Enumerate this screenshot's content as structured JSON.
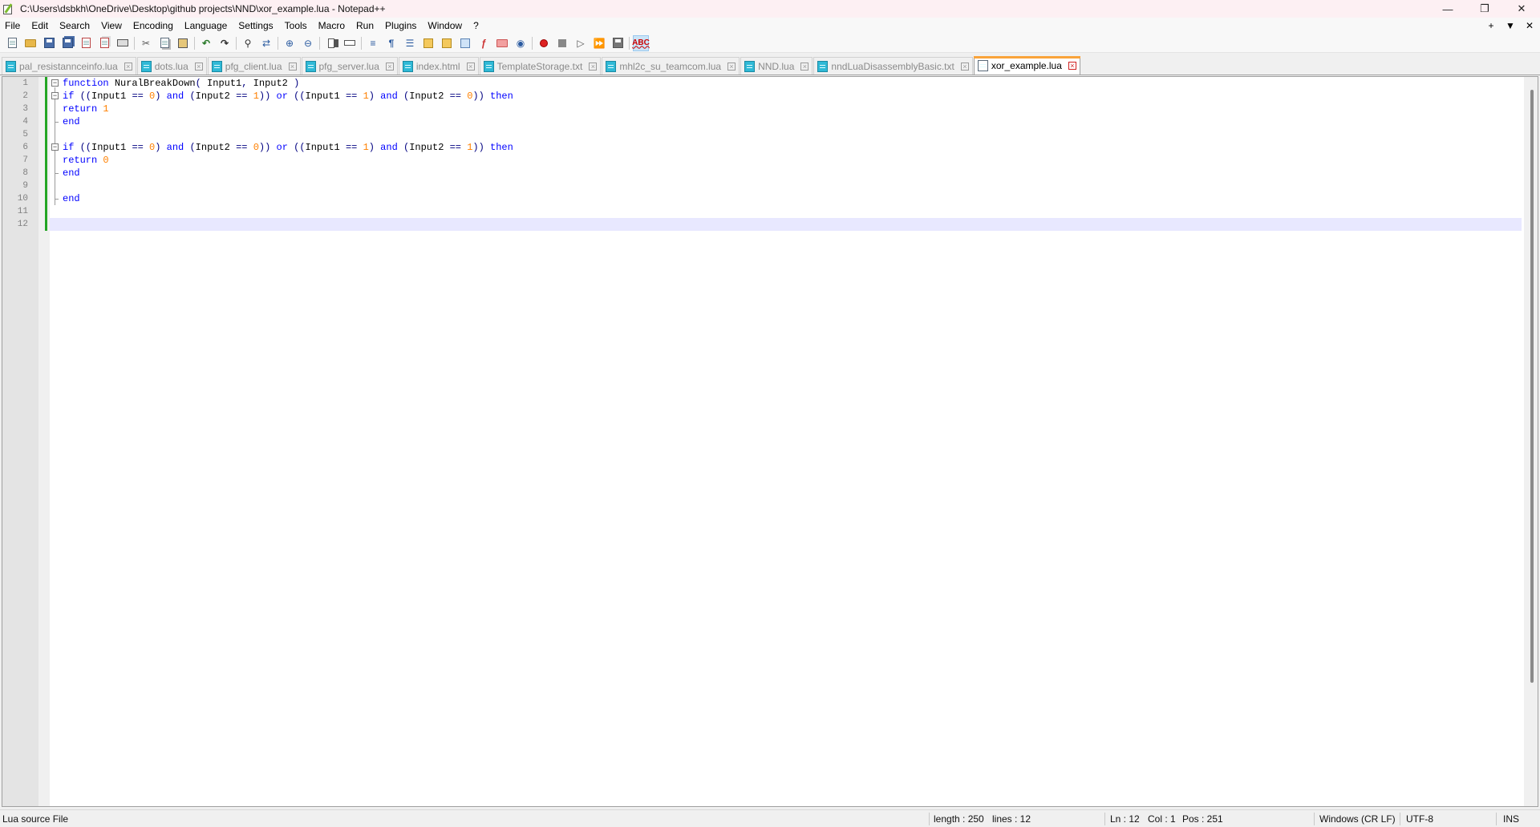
{
  "window": {
    "title": "C:\\Users\\dsbkh\\OneDrive\\Desktop\\github projects\\NND\\xor_example.lua - Notepad++",
    "controls": {
      "minimize": "—",
      "restore": "❐",
      "close": "✕"
    }
  },
  "menu": {
    "items": [
      "File",
      "Edit",
      "Search",
      "View",
      "Encoding",
      "Language",
      "Settings",
      "Tools",
      "Macro",
      "Run",
      "Plugins",
      "Window",
      "?"
    ],
    "right": {
      "add": "+",
      "dropdown": "▼",
      "close": "✕"
    }
  },
  "toolbar": {
    "icons": [
      "new-file-icon",
      "open-file-icon",
      "save-icon",
      "save-all-icon",
      "close-icon",
      "close-all-icon",
      "print-icon",
      "cut-icon",
      "copy-icon",
      "paste-icon",
      "undo-icon",
      "redo-icon",
      "find-icon",
      "replace-icon",
      "zoom-in-icon",
      "zoom-out-icon",
      "sync-vertical-icon",
      "sync-horizontal-icon",
      "word-wrap-icon",
      "show-all-chars-icon",
      "indent-guide-icon",
      "udl-icon",
      "doc-map-icon",
      "doc-list-icon",
      "function-list-icon",
      "folder-workspace-icon",
      "monitoring-icon",
      "record-macro-icon",
      "stop-macro-icon",
      "play-macro-icon",
      "run-multiple-macro-icon",
      "save-macro-icon",
      "spell-check-icon"
    ]
  },
  "tabs": [
    {
      "label": "pal_resistannceinfo.lua",
      "active": false
    },
    {
      "label": "dots.lua",
      "active": false
    },
    {
      "label": "pfg_client.lua",
      "active": false
    },
    {
      "label": "pfg_server.lua",
      "active": false
    },
    {
      "label": "index.html",
      "active": false
    },
    {
      "label": "TemplateStorage.txt",
      "active": false
    },
    {
      "label": "mhl2c_su_teamcom.lua",
      "active": false
    },
    {
      "label": "NND.lua",
      "active": false
    },
    {
      "label": "nndLuaDisassemblyBasic.txt",
      "active": false
    },
    {
      "label": "xor_example.lua",
      "active": true
    }
  ],
  "editor": {
    "line_numbers": [
      "1",
      "2",
      "3",
      "4",
      "5",
      "6",
      "7",
      "8",
      "9",
      "10",
      "11",
      "12"
    ],
    "lines": [
      "function NuralBreakDown( Input1, Input2 )",
      "if ((Input1 == 0) and (Input2 == 1)) or ((Input1 == 1) and (Input2 == 0)) then",
      "return 1",
      "end",
      "",
      "if ((Input1 == 0) and (Input2 == 0)) or ((Input1 == 1) and (Input2 == 1)) then",
      "return 0",
      "end",
      "",
      "end",
      "",
      ""
    ],
    "current_line": 12,
    "colors": {
      "keyword": "#0000ff",
      "number": "#ff8000",
      "identifier": "#000000",
      "current_line_bg": "#e8e8ff",
      "change_bar": "#23a523"
    }
  },
  "status": {
    "language": "Lua source File",
    "length": "length : 250",
    "lines": "lines : 12",
    "ln": "Ln : 12",
    "col": "Col : 1",
    "pos": "Pos : 251",
    "eol": "Windows (CR LF)",
    "encoding": "UTF-8",
    "mode": "INS"
  }
}
